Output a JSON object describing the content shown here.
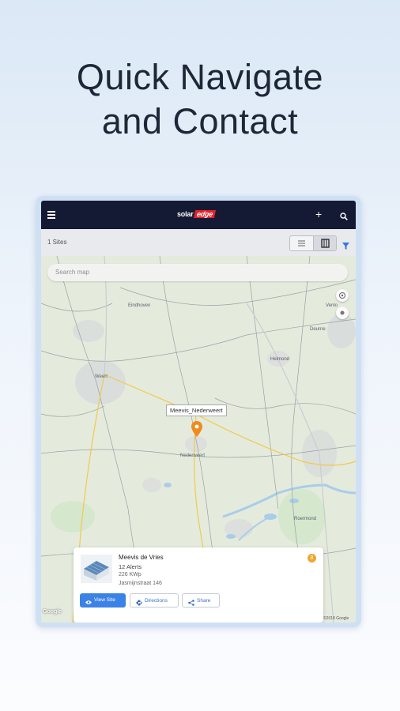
{
  "headline": {
    "line1": "Quick Navigate",
    "line2": "and Contact"
  },
  "app": {
    "logo_left": "solar",
    "logo_right": "edge",
    "add_label": "+",
    "sites_count": "1 Sites"
  },
  "map": {
    "search_placeholder": "Search map",
    "pin_callout": "Meevis_Nederweert",
    "google_label": "Google",
    "copyright": "©2018 Google",
    "place_labels": [
      "Weert",
      "Nederweert",
      "Helmond",
      "Deurne",
      "Venlo",
      "Roermond",
      "Eindhoven"
    ]
  },
  "site_card": {
    "name": "Meevis de Vries",
    "alerts": "12 Alerts",
    "power": "226 KWp",
    "address": "Jasmijnstraat 146",
    "badge": "8",
    "view_site_label": "View Site",
    "directions_label": "Directions",
    "share_label": "Share"
  },
  "colors": {
    "topbar": "#141a33",
    "accent": "#3b82e6",
    "pin": "#f08a1d",
    "logo_red": "#e0222a"
  },
  "icons": [
    "menu-icon",
    "plus-icon",
    "search-icon",
    "list-view-icon",
    "map-view-icon",
    "filter-icon",
    "location-target-icon",
    "compass-icon",
    "map-pin-icon",
    "eye-icon",
    "directions-icon",
    "share-icon"
  ]
}
